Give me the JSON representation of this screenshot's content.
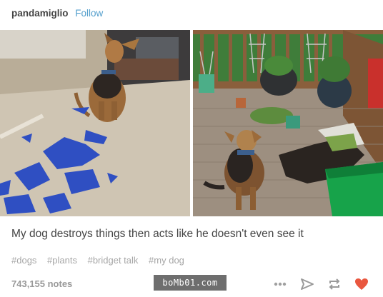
{
  "post": {
    "username": "pandamiglio",
    "follow_label": "Follow",
    "caption": "My dog destroys things then acts like he doesn't even see it",
    "tags": [
      "#dogs",
      "#plants",
      "#bridget talk",
      "#my dog"
    ],
    "notes": "743,155 notes",
    "watermark": "boMb01.com"
  },
  "icons": {
    "more": "ellipsis-icon",
    "share": "send-arrow-icon",
    "reblog": "reblog-icon",
    "like": "heart-icon"
  },
  "colors": {
    "follow": "#529ecc",
    "heart": "#e9573f",
    "tag": "#a7a7a7"
  }
}
